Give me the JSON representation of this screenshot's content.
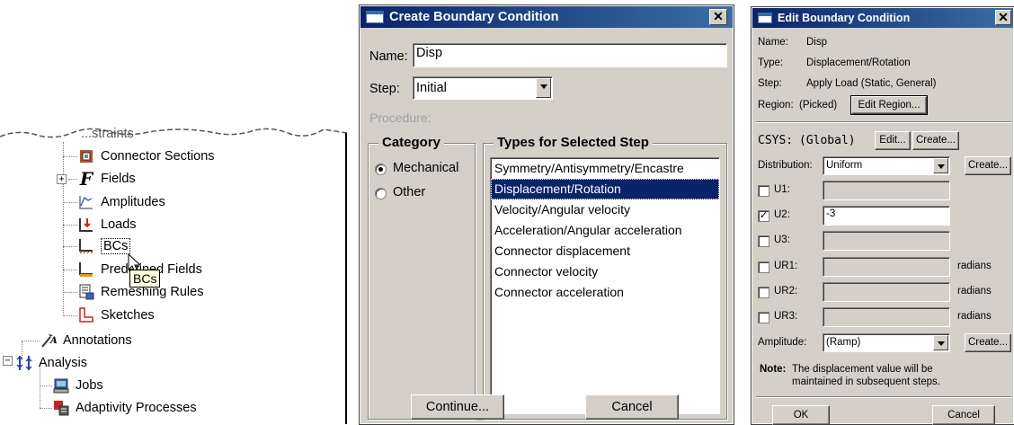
{
  "tree": {
    "partial_top_label": "...straints",
    "items": [
      {
        "label": "Connector Sections",
        "icon": "connector-sections-icon"
      },
      {
        "label": "Fields",
        "icon": "fields-icon",
        "expander": "+"
      },
      {
        "label": "Amplitudes",
        "icon": "amplitudes-icon"
      },
      {
        "label": "Loads",
        "icon": "loads-icon"
      },
      {
        "label": "BCs",
        "icon": "bcs-icon"
      },
      {
        "label": "Predefined Fields",
        "icon": "predefined-fields-icon"
      },
      {
        "label": "Remeshing Rules",
        "icon": "remeshing-rules-icon"
      },
      {
        "label": "Sketches",
        "icon": "sketches-icon"
      },
      {
        "label": "Annotations",
        "icon": "annotations-icon"
      },
      {
        "label": "Analysis",
        "icon": "analysis-icon",
        "expander": "−"
      },
      {
        "label": "Jobs",
        "icon": "jobs-icon"
      },
      {
        "label": "Adaptivity Processes",
        "icon": "adaptivity-processes-icon"
      }
    ],
    "tooltip": "BCs"
  },
  "create_dialog": {
    "title": "Create Boundary Condition",
    "close": "✕",
    "name_label": "Name:",
    "name_value": "Disp",
    "step_label": "Step:",
    "step_value": "Initial",
    "procedure_label": "Procedure:",
    "category_title": "Category",
    "categories": [
      "Mechanical",
      "Other"
    ],
    "types_title": "Types for Selected Step",
    "types": [
      "Symmetry/Antisymmetry/Encastre",
      "Displacement/Rotation",
      "Velocity/Angular velocity",
      "Acceleration/Angular acceleration",
      "Connector displacement",
      "Connector velocity",
      "Connector acceleration"
    ],
    "selected_type_index": 1,
    "continue_label": "Continue...",
    "cancel_label": "Cancel"
  },
  "edit_dialog": {
    "title": "Edit Boundary Condition",
    "close": "✕",
    "name_label": "Name:",
    "name_value": "Disp",
    "type_label": "Type:",
    "type_value": "Displacement/Rotation",
    "step_label": "Step:",
    "step_value": "Apply Load (Static, General)",
    "region_label": "Region:",
    "region_value": "(Picked)",
    "edit_region_label": "Edit Region...",
    "csys_label": "CSYS:",
    "csys_value": "(Global)",
    "csys_edit_label": "Edit...",
    "csys_create_label": "Create...",
    "distribution_label": "Distribution:",
    "distribution_value": "Uniform",
    "distribution_create_label": "Create...",
    "dofs": [
      {
        "label": "U1:",
        "checked": false,
        "value": "",
        "unit": ""
      },
      {
        "label": "U2:",
        "checked": true,
        "value": "-3",
        "unit": ""
      },
      {
        "label": "U3:",
        "checked": false,
        "value": "",
        "unit": ""
      },
      {
        "label": "UR1:",
        "checked": false,
        "value": "",
        "unit": "radians"
      },
      {
        "label": "UR2:",
        "checked": false,
        "value": "",
        "unit": "radians"
      },
      {
        "label": "UR3:",
        "checked": false,
        "value": "",
        "unit": "radians"
      }
    ],
    "amplitude_label": "Amplitude:",
    "amplitude_value": "(Ramp)",
    "amplitude_create_label": "Create...",
    "note_label": "Note:",
    "note_line1": "The displacement value will be",
    "note_line2": "maintained in subsequent steps.",
    "ok_label": "OK",
    "cancel_label": "Cancel"
  }
}
